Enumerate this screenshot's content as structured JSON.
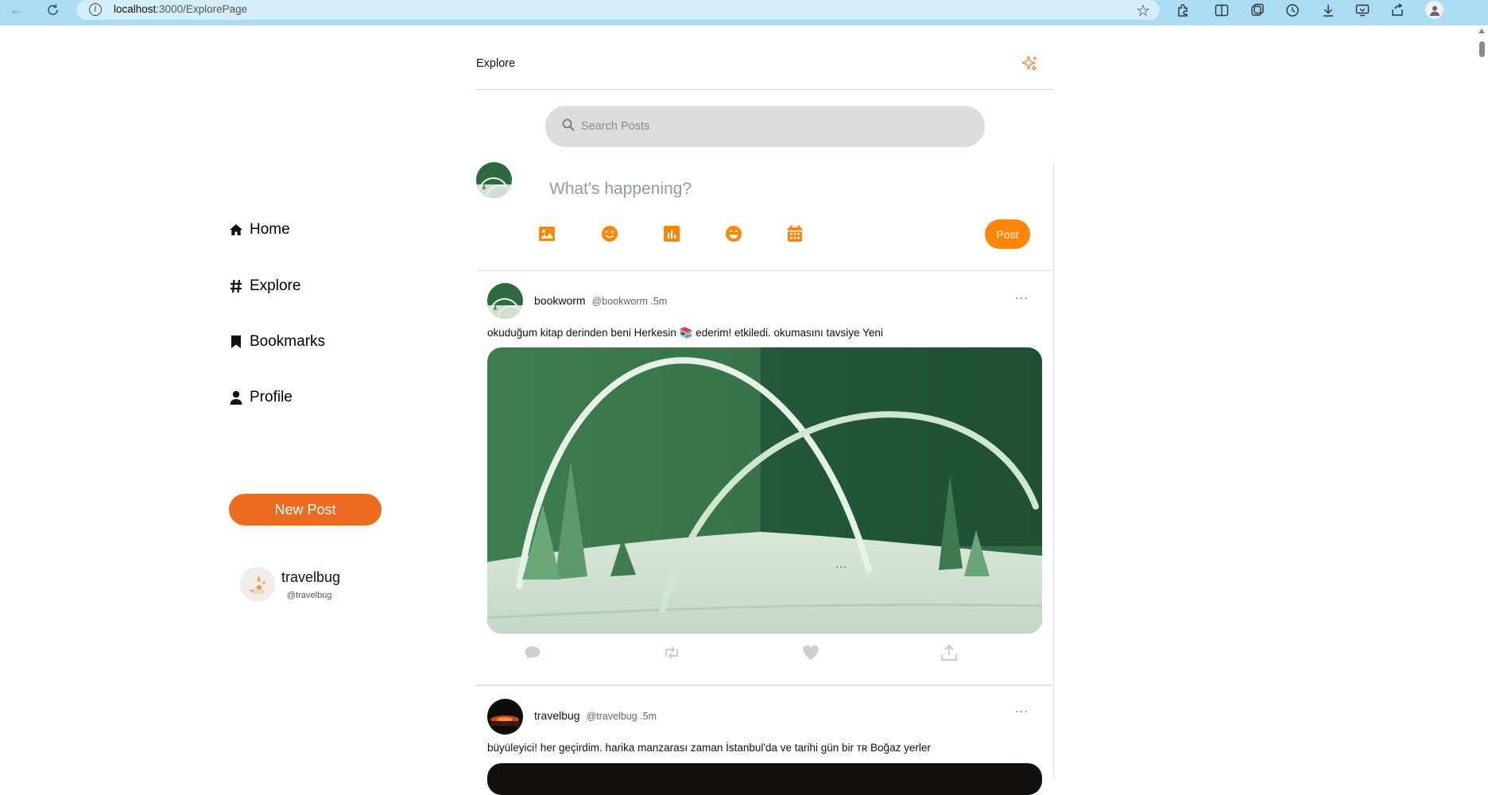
{
  "browser": {
    "url_host": "localhost",
    "url_path": ":3000/ExplorePage"
  },
  "header": {
    "title": "Explore"
  },
  "sidebar": {
    "items": [
      {
        "label": "Home",
        "icon": "home-icon"
      },
      {
        "label": "Explore",
        "icon": "hashtag-icon"
      },
      {
        "label": "Bookmarks",
        "icon": "bookmark-icon"
      },
      {
        "label": "Profile",
        "icon": "user-icon"
      }
    ],
    "new_post_label": "New Post",
    "user": {
      "name": "travelbug",
      "handle": "@travelbug"
    }
  },
  "search": {
    "placeholder": "Search Posts"
  },
  "compose": {
    "placeholder": "What's happening?",
    "post_label": "Post",
    "tools": [
      "image-icon",
      "emoji-icon",
      "poll-icon",
      "laugh-icon",
      "calendar-icon"
    ]
  },
  "posts": [
    {
      "name": "bookworm",
      "handle": "@bookworm",
      "time": ".5m",
      "text": "okuduğum kitap derinden beni Herkesin 📚 ederim! etkiledi. okumasını tavsiye Yeni",
      "more": "···"
    },
    {
      "name": "travelbug",
      "handle": "@travelbug",
      "time": ".5m",
      "text": "büyüleyici! her geçirdim. harika manzarası zaman İstanbul'da ve tarihi gün bir ᴛʀ Boğaz yerler",
      "more": "···"
    }
  ],
  "colors": {
    "accent_orange": "#ff8607",
    "new_post_orange": "#ec6b1e",
    "chrome_blue": "#aadcf4"
  }
}
